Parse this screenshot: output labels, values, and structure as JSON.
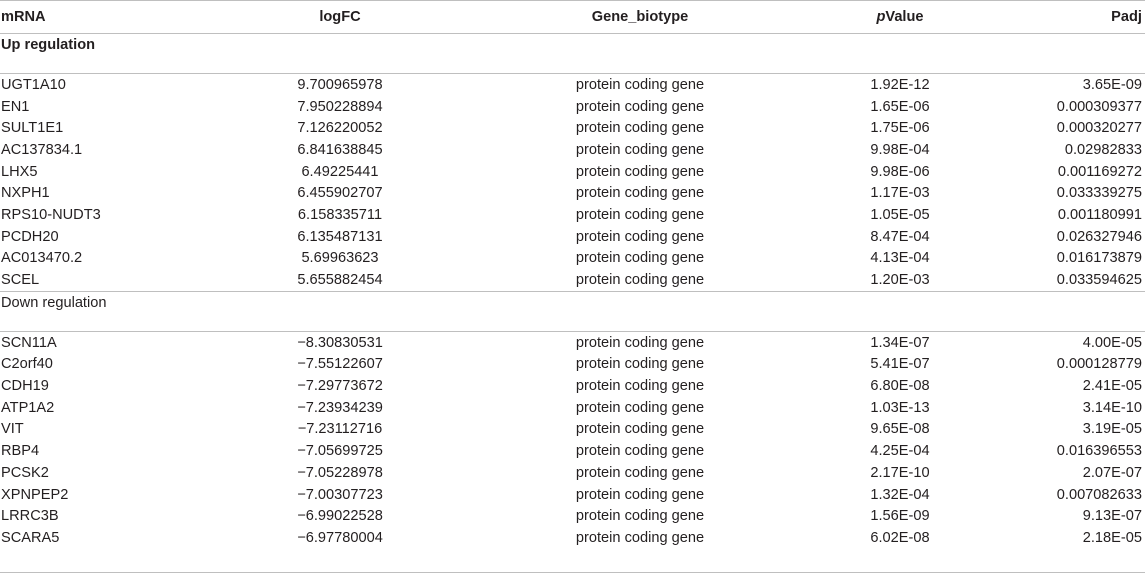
{
  "headers": {
    "mrna": "mRNA",
    "logfc": "logFC",
    "biotype": "Gene_biotype",
    "pvalue_italic": "p",
    "pvalue_rest": "Value",
    "padj": "Padj"
  },
  "up": {
    "label": "Up regulation",
    "rows": [
      {
        "mrna": "UGT1A10",
        "logfc": "9.700965978",
        "biotype": "protein coding gene",
        "pvalue": "1.92E-12",
        "padj": "3.65E-09"
      },
      {
        "mrna": "EN1",
        "logfc": "7.950228894",
        "biotype": "protein coding gene",
        "pvalue": "1.65E-06",
        "padj": "0.000309377"
      },
      {
        "mrna": "SULT1E1",
        "logfc": "7.126220052",
        "biotype": "protein coding gene",
        "pvalue": "1.75E-06",
        "padj": "0.000320277"
      },
      {
        "mrna": "AC137834.1",
        "logfc": "6.841638845",
        "biotype": "protein coding gene",
        "pvalue": "9.98E-04",
        "padj": "0.02982833"
      },
      {
        "mrna": "LHX5",
        "logfc": "6.49225441",
        "biotype": "protein coding gene",
        "pvalue": "9.98E-06",
        "padj": "0.001169272"
      },
      {
        "mrna": "NXPH1",
        "logfc": "6.455902707",
        "biotype": "protein coding gene",
        "pvalue": "1.17E-03",
        "padj": "0.033339275"
      },
      {
        "mrna": "RPS10-NUDT3",
        "logfc": "6.158335711",
        "biotype": "protein coding gene",
        "pvalue": "1.05E-05",
        "padj": "0.001180991"
      },
      {
        "mrna": "PCDH20",
        "logfc": "6.135487131",
        "biotype": "protein coding gene",
        "pvalue": "8.47E-04",
        "padj": "0.026327946"
      },
      {
        "mrna": "AC013470.2",
        "logfc": "5.69963623",
        "biotype": "protein coding gene",
        "pvalue": "4.13E-04",
        "padj": "0.016173879"
      },
      {
        "mrna": "SCEL",
        "logfc": "5.655882454",
        "biotype": "protein coding gene",
        "pvalue": "1.20E-03",
        "padj": "0.033594625"
      }
    ]
  },
  "down": {
    "label": "Down regulation",
    "rows": [
      {
        "mrna": "SCN11A",
        "logfc": "−8.30830531",
        "biotype": "protein coding gene",
        "pvalue": "1.34E-07",
        "padj": "4.00E-05"
      },
      {
        "mrna": "C2orf40",
        "logfc": "−7.55122607",
        "biotype": "protein coding gene",
        "pvalue": "5.41E-07",
        "padj": "0.000128779"
      },
      {
        "mrna": "CDH19",
        "logfc": "−7.29773672",
        "biotype": "protein coding gene",
        "pvalue": "6.80E-08",
        "padj": "2.41E-05"
      },
      {
        "mrna": "ATP1A2",
        "logfc": "−7.23934239",
        "biotype": "protein coding gene",
        "pvalue": "1.03E-13",
        "padj": "3.14E-10"
      },
      {
        "mrna": "VIT",
        "logfc": "−7.23112716",
        "biotype": "protein coding gene",
        "pvalue": "9.65E-08",
        "padj": "3.19E-05"
      },
      {
        "mrna": "RBP4",
        "logfc": "−7.05699725",
        "biotype": "protein coding gene",
        "pvalue": "4.25E-04",
        "padj": "0.016396553"
      },
      {
        "mrna": "PCSK2",
        "logfc": "−7.05228978",
        "biotype": "protein coding gene",
        "pvalue": "2.17E-10",
        "padj": "2.07E-07"
      },
      {
        "mrna": "XPNPEP2",
        "logfc": "−7.00307723",
        "biotype": "protein coding gene",
        "pvalue": "1.32E-04",
        "padj": "0.007082633"
      },
      {
        "mrna": "LRRC3B",
        "logfc": "−6.99022528",
        "biotype": "protein coding gene",
        "pvalue": "1.56E-09",
        "padj": "9.13E-07"
      },
      {
        "mrna": "SCARA5",
        "logfc": "−6.97780004",
        "biotype": "protein coding gene",
        "pvalue": "6.02E-08",
        "padj": "2.18E-05"
      }
    ]
  }
}
